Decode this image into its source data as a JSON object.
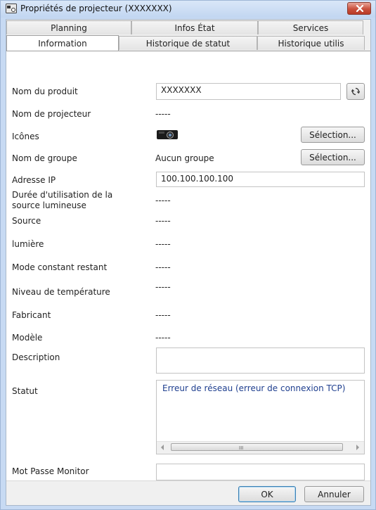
{
  "window": {
    "title": "Propriétés de projecteur (XXXXXXX)"
  },
  "tabs": {
    "row1": [
      "Planning",
      "Infos État",
      "Services"
    ],
    "row2": [
      "Information",
      "Historique de statut",
      "Historique utilis"
    ]
  },
  "form": {
    "product_name_label": "Nom du produit",
    "product_name_value": "XXXXXXX",
    "projector_name_label": "Nom de projecteur",
    "projector_name_value": "-----",
    "icons_label": "Icônes",
    "icons_button": "Sélection...",
    "group_label": "Nom de groupe",
    "group_value": "Aucun groupe",
    "group_button": "Sélection...",
    "ip_label": "Adresse IP",
    "ip_value": "100.100.100.100",
    "light_hours_label_1": "Durée d'utilisation de la",
    "light_hours_label_2": "source lumineuse",
    "light_hours_value": "-----",
    "source_label": "Source",
    "source_value": "-----",
    "light_label": "lumière",
    "light_value": "-----",
    "constant_mode_label": "Mode constant restant",
    "constant_mode_value": "-----",
    "temperature_label": "Niveau de température",
    "temperature_value": "-----",
    "manufacturer_label": "Fabricant",
    "manufacturer_value": "-----",
    "model_label": "Modèle",
    "model_value": "-----",
    "description_label": "Description",
    "description_value": "",
    "status_label": "Statut",
    "status_value": "Erreur de réseau (erreur de connexion TCP)",
    "monitor_password_label": "Mot Passe Monitor",
    "monitor_password_value": ""
  },
  "footer": {
    "ok": "OK",
    "cancel": "Annuler"
  }
}
